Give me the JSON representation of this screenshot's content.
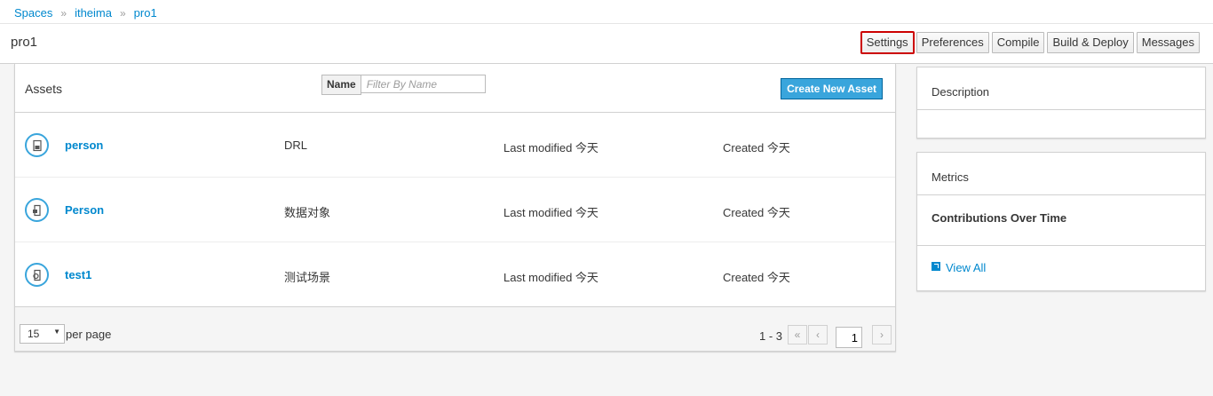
{
  "breadcrumb": [
    "Spaces",
    "itheima",
    "pro1"
  ],
  "header": {
    "project_title": "pro1",
    "buttons": [
      "Settings",
      "Preferences",
      "Compile",
      "Build & Deploy",
      "Messages"
    ]
  },
  "assets": {
    "title": "Assets",
    "filter_label": "Name",
    "filter_placeholder": "Filter By Name",
    "create_label": "Create New Asset",
    "rows": [
      {
        "name": "person",
        "type": "DRL",
        "modified": "Last modified 今天",
        "created": "Created 今天",
        "icon": "drl-file-icon"
      },
      {
        "name": "Person",
        "type": "数据对象",
        "modified": "Last modified 今天",
        "created": "Created 今天",
        "icon": "data-object-icon"
      },
      {
        "name": "test1",
        "type": "测试场景",
        "modified": "Last modified 今天",
        "created": "Created 今天",
        "icon": "test-scenario-icon"
      }
    ],
    "pagination": {
      "page_size": "15",
      "per_page_label": "per page",
      "range": "1 - 3",
      "current_page": "1"
    }
  },
  "sidebar": {
    "description_title": "Description",
    "metrics_title": "Metrics",
    "contributions_title": "Contributions Over Time",
    "view_all_label": "View All"
  }
}
